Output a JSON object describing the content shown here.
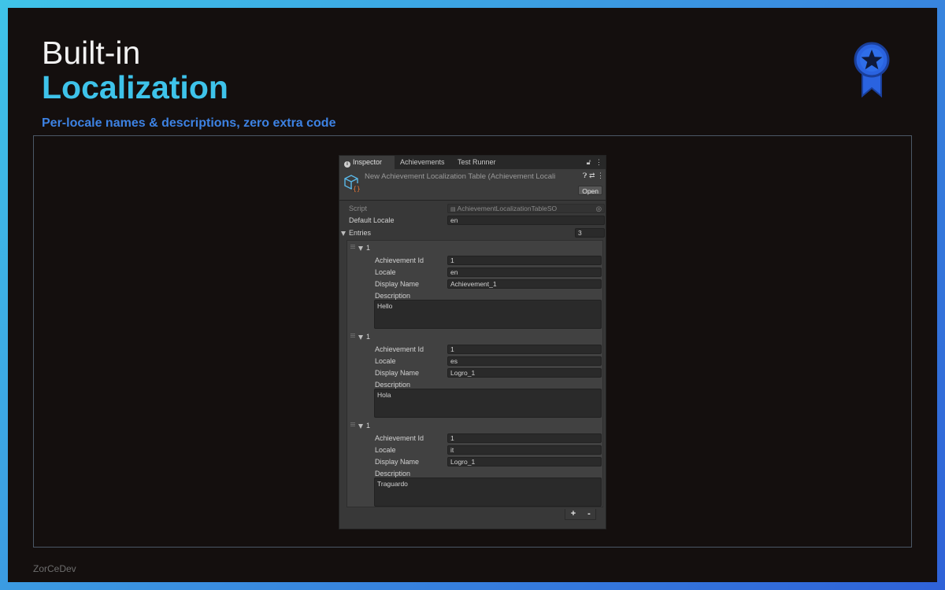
{
  "slide": {
    "title_line1": "Built-in",
    "title_line2": "Localization",
    "subtitle": "Per-locale names & descriptions, zero extra code",
    "footer": "ZorCeDev",
    "badge_icon": "award-ribbon-star-icon"
  },
  "inspector": {
    "tabs": [
      {
        "label": "Inspector",
        "icon": "info-icon",
        "active": true
      },
      {
        "label": "Achievements",
        "active": false
      },
      {
        "label": "Test Runner",
        "active": false
      }
    ],
    "header_title": "New Achievement Localization Table (Achievement Locali",
    "open_label": "Open",
    "script_label": "Script",
    "script_value": "AchievementLocalizationTableSO",
    "default_locale_label": "Default Locale",
    "default_locale_value": "en",
    "entries_label": "Entries",
    "entries_count": "3",
    "field_labels": {
      "achievement_id": "Achievement Id",
      "locale": "Locale",
      "display_name": "Display Name",
      "description": "Description"
    },
    "entries": [
      {
        "header": "1",
        "achievement_id": "1",
        "locale": "en",
        "display_name": "Achievement_1",
        "description": "Hello"
      },
      {
        "header": "1",
        "achievement_id": "1",
        "locale": "es",
        "display_name": "Logro_1",
        "description": "Hola"
      },
      {
        "header": "1",
        "achievement_id": "1",
        "locale": "it",
        "display_name": "Logro_1",
        "description": "Traguardo"
      }
    ],
    "add_label": "+",
    "remove_label": "-"
  },
  "colors": {
    "accent_cyan": "#3ec3ea",
    "accent_blue": "#3d82e3",
    "badge_blue": "#2a63e0"
  }
}
